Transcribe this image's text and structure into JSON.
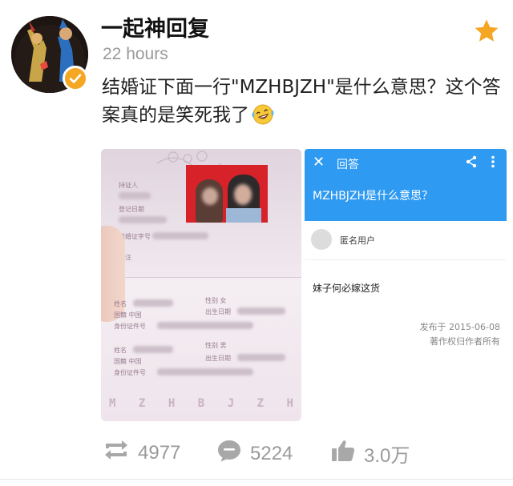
{
  "post": {
    "username": "一起神回复",
    "timestamp": "22 hours",
    "text": "结婚证下面一行\"MZHBJZH\"是什么意思？这个答案真的是笑死我了",
    "emoji_icon": "laughing-tears-emoji-icon",
    "favorite_icon": "star-icon",
    "verified_icon": "verified-badge-icon"
  },
  "certificate_image": {
    "mrz_letters": [
      "M",
      "Z",
      "H",
      "B",
      "J",
      "Z",
      "H"
    ],
    "labels": {
      "holder": "持证人",
      "reg_date": "登记日期",
      "cert_no": "结婚证字号",
      "note": "备注",
      "name1": "姓名",
      "nation1": "国籍  中国",
      "id1": "身份证件号",
      "gender1": "性别  女",
      "dob1": "出生日期",
      "name2": "姓名",
      "nation2": "国籍  中国",
      "id2": "身份证件号",
      "gender2": "性别  男",
      "dob2": "出生日期"
    }
  },
  "answer_image": {
    "header_title": "回答",
    "question": "MZHBJZH是什么意思？",
    "anonymous_user": "匿名用户",
    "answer_text": "妹子何必嫁这货",
    "published": "发布于 2015-06-08",
    "copyright": "著作权归作者所有",
    "close_icon": "close-icon",
    "share_icon": "share-icon",
    "more_icon": "more-vertical-icon"
  },
  "actions": {
    "repost_count": "4977",
    "comment_count": "5224",
    "like_count": "3.0万"
  },
  "colors": {
    "accent_orange": "#f5a623",
    "answer_header_blue": "#2f9af2",
    "action_gray": "#9a9a9a",
    "photo_red": "#d8222a"
  }
}
